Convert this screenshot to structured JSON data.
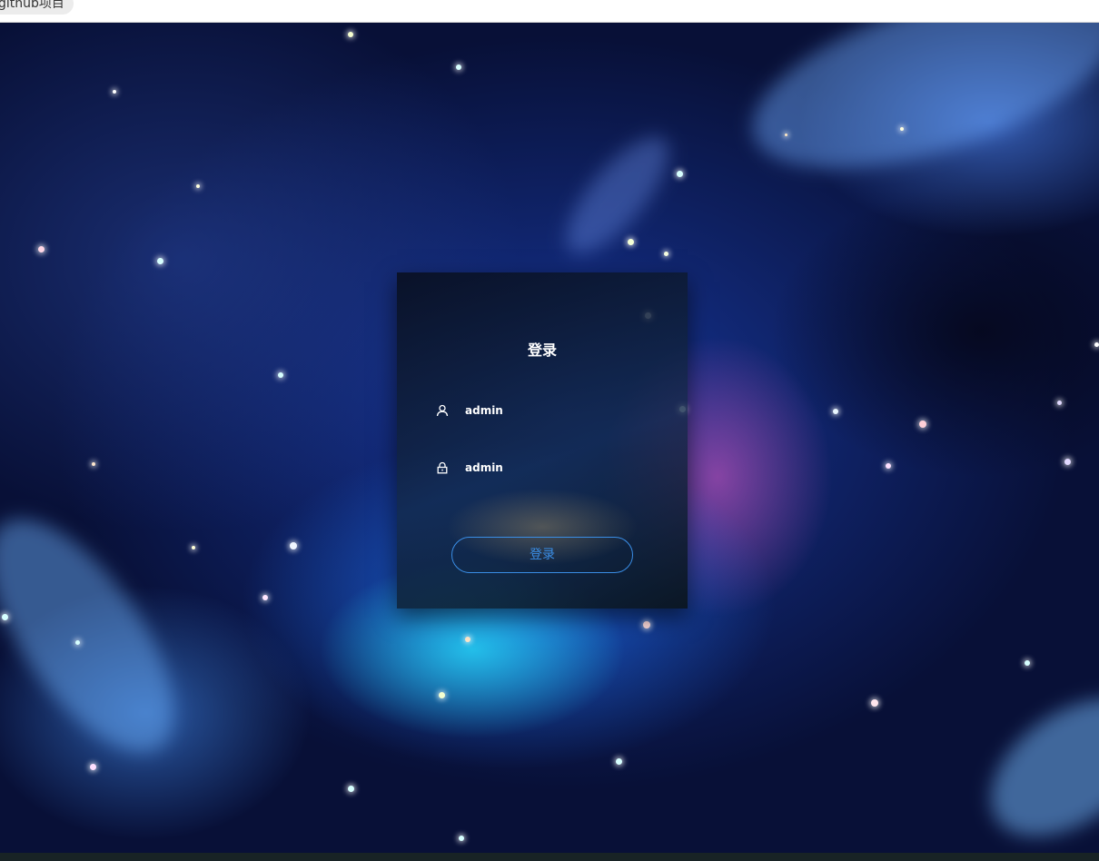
{
  "bookmark": {
    "label": "github项目"
  },
  "login": {
    "title": "登录",
    "username_value": "admin",
    "password_value": "admin",
    "submit_label": "登录",
    "user_icon": "user-icon",
    "lock_icon": "lock-icon"
  },
  "colors": {
    "button_border": "#3a8ee6",
    "button_text": "#3a8ee6",
    "title_text": "#ffffff"
  }
}
